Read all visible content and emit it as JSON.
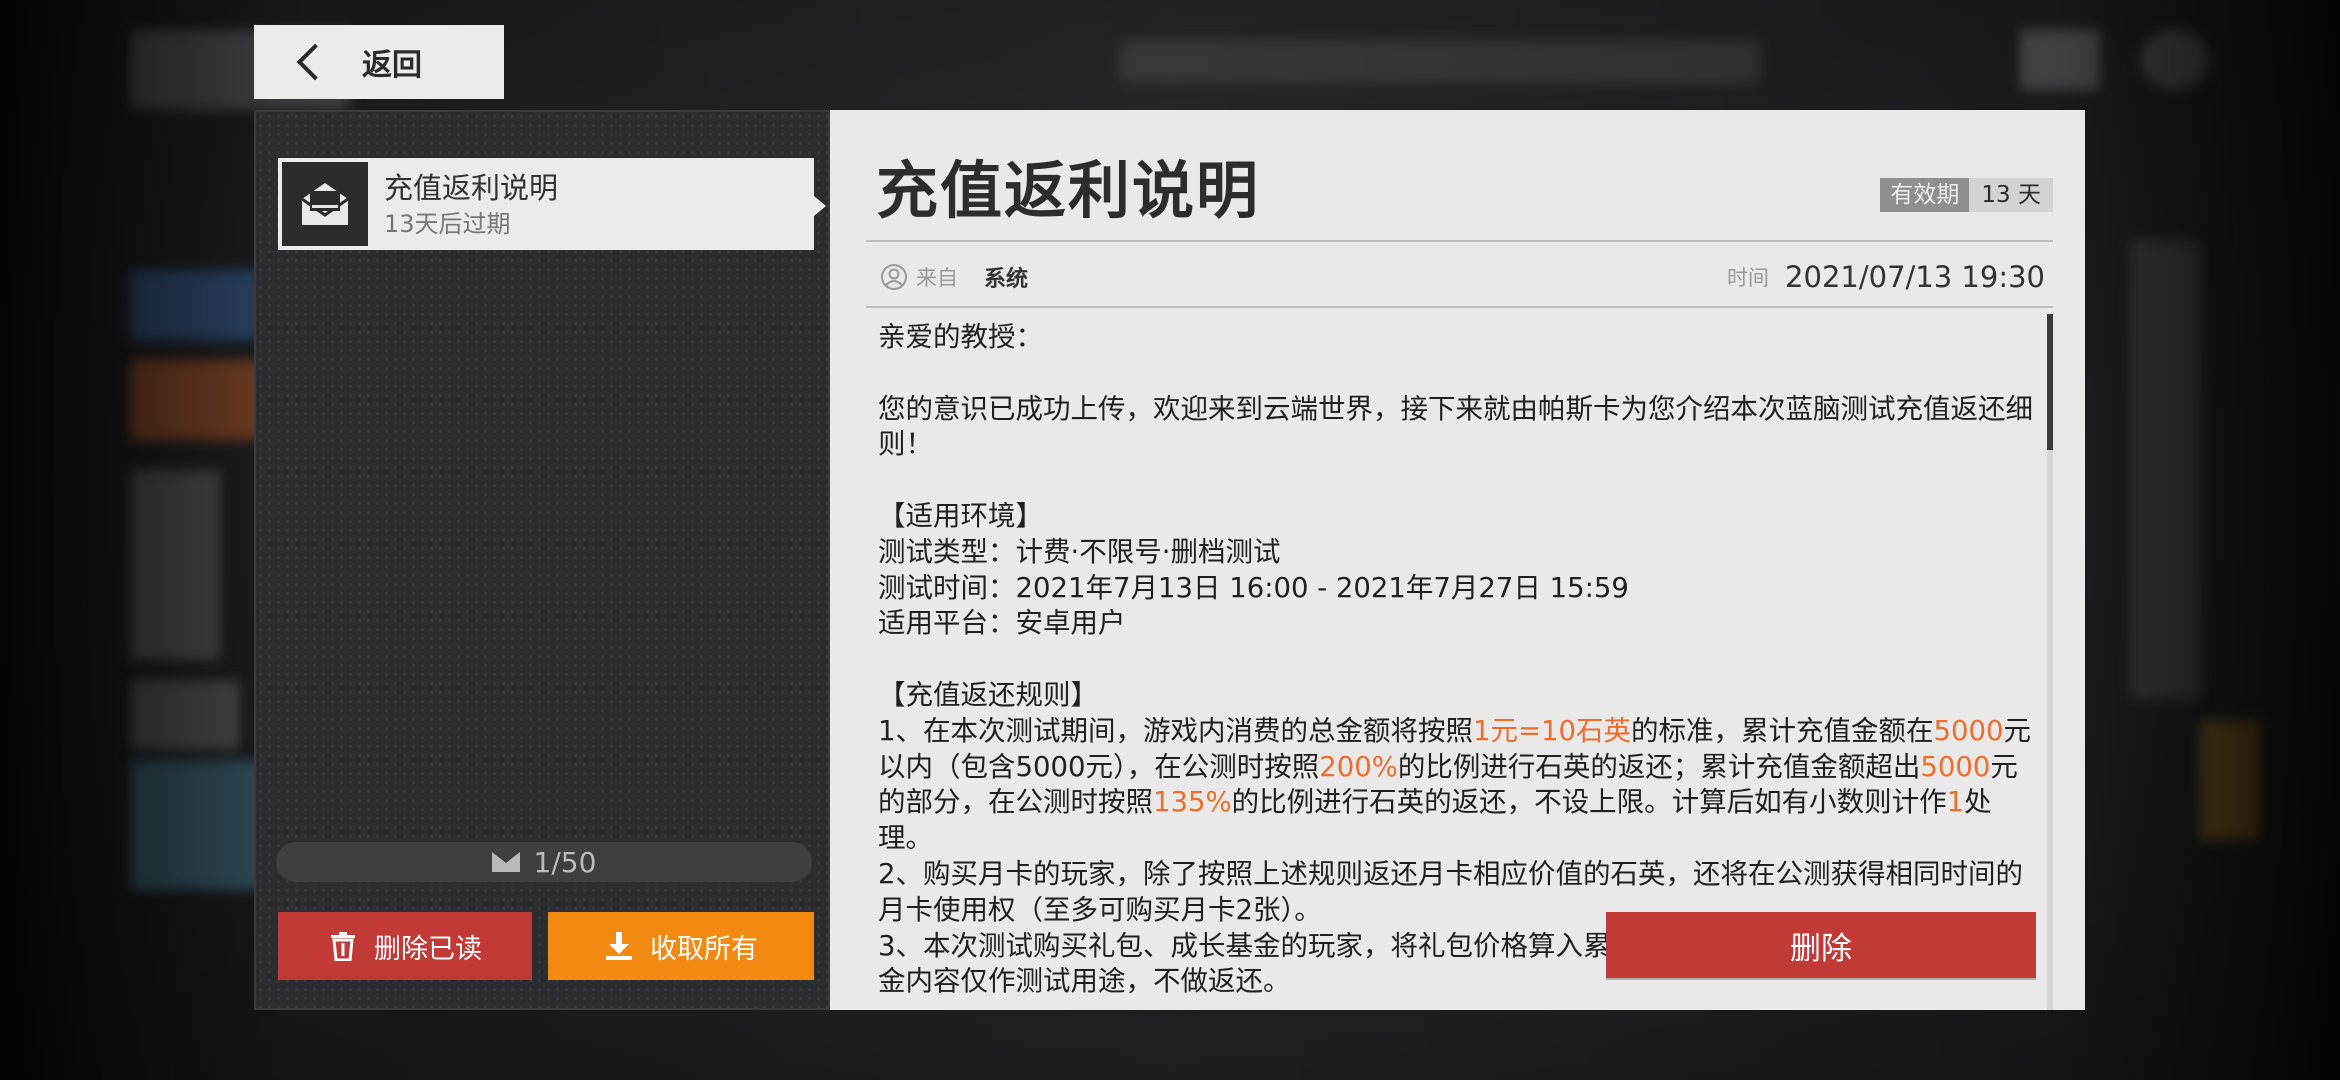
{
  "nav": {
    "back_label": "返回"
  },
  "mail_list": {
    "items": [
      {
        "title": "充值返利说明",
        "subtitle": "13天后过期"
      }
    ],
    "counter": "1/50",
    "delete_read_label": "删除已读",
    "collect_all_label": "收取所有"
  },
  "mail": {
    "title": "充值返利说明",
    "validity_label": "有效期",
    "validity_value": "13 天",
    "from_label": "来自",
    "from_value": "系统",
    "time_label": "时间",
    "time_value": "2021/07/13 19:30",
    "body": {
      "greeting": "亲爱的教授：",
      "intro": "您的意识已成功上传，欢迎来到云端世界，接下来就由帕斯卡为您介绍本次蓝脑测试充值返还细则！",
      "env_heading": "【适用环境】",
      "env_type": "测试类型：计费·不限号·删档测试",
      "env_time": "测试时间：2021年7月13日 16:00 - 2021年7月27日 15:59",
      "env_platform": "适用平台：安卓用户",
      "rules_heading": "【充值返还规则】",
      "rule1": {
        "a": "1、在本次测试期间，游戏内消费的总金额将按照",
        "h1": "1元=10石英",
        "b": "的标准，累计充值金额在",
        "h2": "5000",
        "c": "元以内（包含5000元），在公测时按照",
        "h3": "200%",
        "d": "的比例进行石英的返还；累计充值金额超出",
        "h4": "5000",
        "e": "元的部分，在公测时按照",
        "h5": "135%",
        "f": "的比例进行石英的返还，不设上限。计算后如有小数则计作",
        "h6": "1",
        "g": "处理。"
      },
      "rule2": "2、购买月卡的玩家，除了按照上述规则返还月卡相应价值的石英，还将在公测获得相同时间的月卡使用权（至多可购买月卡2张）。",
      "rule3": "3、本次测试购买礼包、成长基金的玩家，将礼包价格算入累计充值金额，但礼包内容及成长基金内容仅作测试用途，不做返还。"
    },
    "delete_label": "删除"
  },
  "colors": {
    "highlight": "#f06d2a",
    "danger": "#c23a36",
    "accent": "#f28a12"
  }
}
